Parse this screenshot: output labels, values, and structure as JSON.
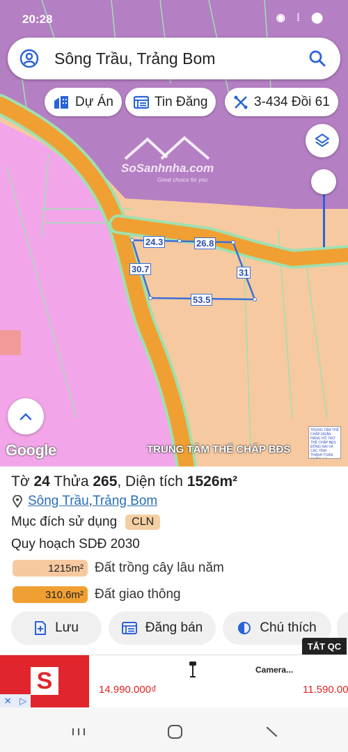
{
  "status_bar": {
    "time": "20:28",
    "right": " "
  },
  "search": {
    "value": "Sông Trầu, Trảng Bom"
  },
  "chips": [
    {
      "label": "Dự Án"
    },
    {
      "label": "Tin Đăng"
    },
    {
      "label": "3-434 Đồi 61"
    }
  ],
  "map": {
    "logo_text": "SoSanhnha.com",
    "logo_sub": "Great choice for you",
    "dimensions": [
      "24.3",
      "26.8",
      "30.7",
      "31",
      "53.5"
    ],
    "google_label": "Google",
    "watermark": "TRUNG TÂM THẾ CHẤP BĐS",
    "sticker_text": "TRUNG TÂM THẾ CHẤP NGÂN HÀNG HỖ TRỢ THẾ CHẤP BĐS ĐỒNG NAI VÀ CÁC TỈNH THÀNH TOÀN QUỐC. LH: 0933370",
    "colors": {
      "residential": "#f7c9a0",
      "purple": "#b57fc4",
      "pink": "#f2a6e9",
      "road": "#f0a032",
      "road_edge": "#9fe0b0",
      "parcel": "#3a6fd8"
    }
  },
  "panel": {
    "title_pre": "Tờ ",
    "sheet": "24",
    "title_mid": " Thửa ",
    "parcel": "265",
    "title_area_label": ", Diện tích ",
    "area": "1526m²",
    "location_a": "Sông Trầu",
    "location_sep": ", ",
    "location_b": "Trảng Bom",
    "purpose_label": "Mục đích sử dụng",
    "purpose_code": "CLN",
    "plan_label": "Quy hoạch SDĐ 2030",
    "legend": [
      {
        "value": "1215m²",
        "label": "Đất trồng cây lâu năm",
        "color": "#f7c9a0"
      },
      {
        "value": "310.6m²",
        "label": "Đất giao thông",
        "color": "#f0a032"
      }
    ],
    "actions": [
      {
        "label": "Lưu"
      },
      {
        "label": "Đăng bán"
      },
      {
        "label": "Chú thích"
      }
    ]
  },
  "ad": {
    "close_badge": "TẮT QC",
    "brand_letter": "S",
    "title": "Camera...",
    "price_1": "14.990.000₫",
    "price_2": "11.590.00"
  }
}
